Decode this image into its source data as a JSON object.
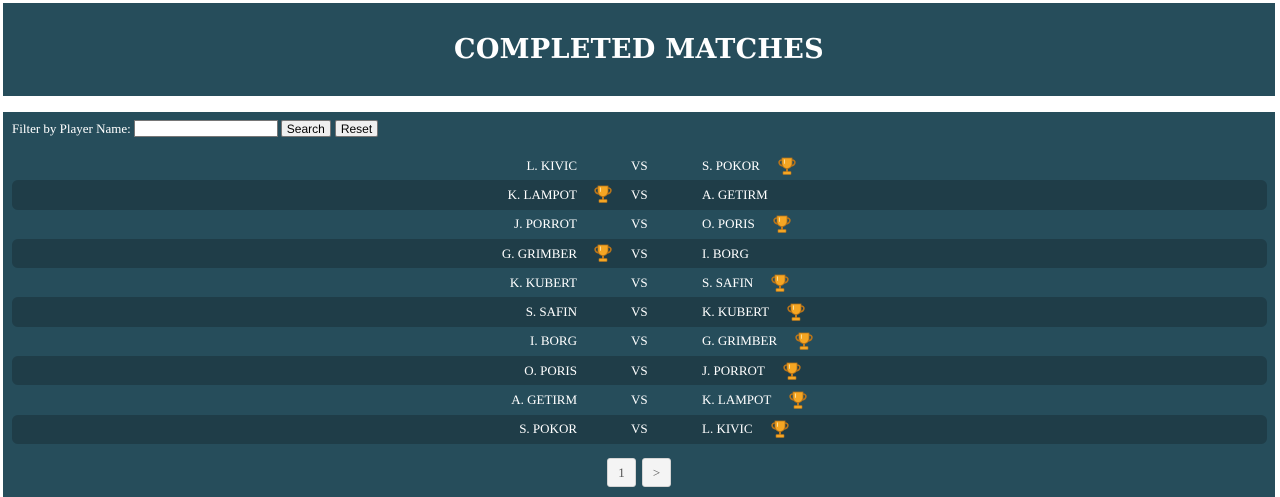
{
  "header": {
    "title": "COMPLETED MATCHES"
  },
  "filter": {
    "label": "Filter by Player Name:",
    "input_value": "",
    "search_label": "Search",
    "reset_label": "Reset"
  },
  "vs_label": "VS",
  "colors": {
    "panel": "#264d5b",
    "row_alt": "#1f3d48",
    "trophy_gold": "#f5a623"
  },
  "matches": [
    {
      "player1": "L. KIVIC",
      "player2": "S. POKOR",
      "winner": 2
    },
    {
      "player1": "K. LAMPOT",
      "player2": "A. GETIRM",
      "winner": 1
    },
    {
      "player1": "J. PORROT",
      "player2": "O. PORIS",
      "winner": 2
    },
    {
      "player1": "G. GRIMBER",
      "player2": "I. BORG",
      "winner": 1
    },
    {
      "player1": "K. KUBERT",
      "player2": "S. SAFIN",
      "winner": 2
    },
    {
      "player1": "S. SAFIN",
      "player2": "K. KUBERT",
      "winner": 2
    },
    {
      "player1": "I. BORG",
      "player2": "G. GRIMBER",
      "winner": 2
    },
    {
      "player1": "O. PORIS",
      "player2": "J. PORROT",
      "winner": 2
    },
    {
      "player1": "A. GETIRM",
      "player2": "K. LAMPOT",
      "winner": 2
    },
    {
      "player1": "S. POKOR",
      "player2": "L. KIVIC",
      "winner": 2
    }
  ],
  "pagination": {
    "current_page": "1",
    "next_label": ">"
  }
}
